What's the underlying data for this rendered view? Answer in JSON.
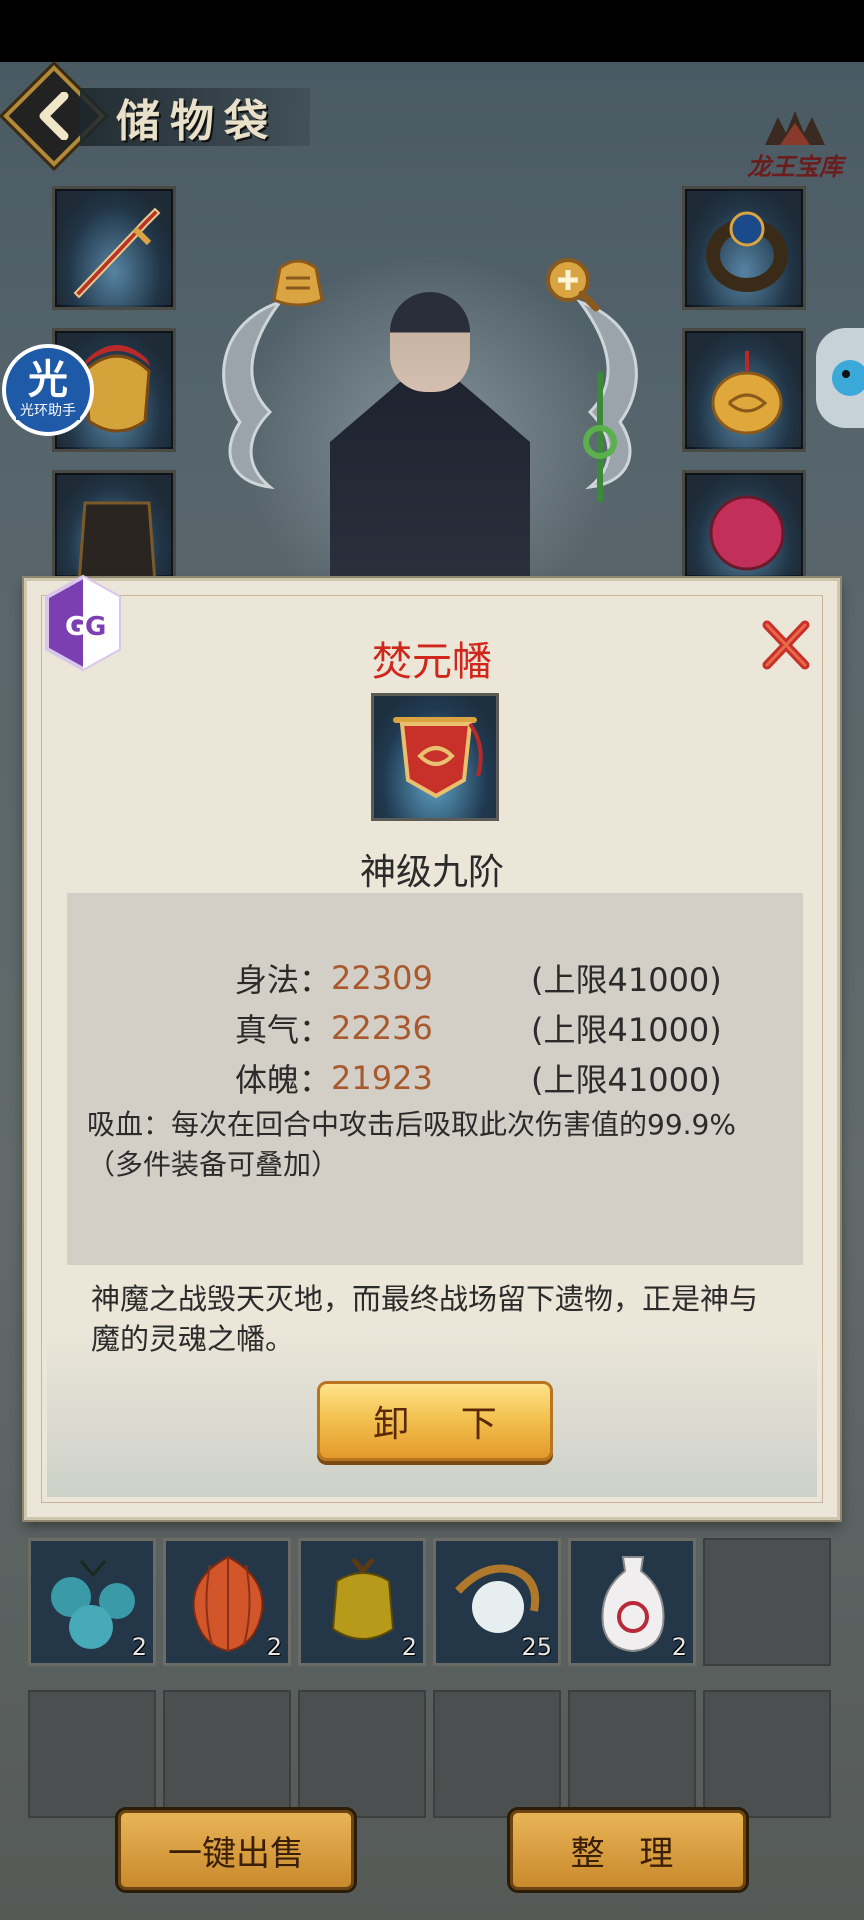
{
  "header": {
    "title": "储物袋",
    "logo_text": "龙王宝库"
  },
  "overlay": {
    "assistant_badge_big": "光",
    "assistant_badge_small": "光环助手"
  },
  "item_detail": {
    "name": "焚元幡",
    "grade": "神级九阶",
    "stats": [
      {
        "label": "身法：",
        "value": "22309",
        "cap": "(上限41000)"
      },
      {
        "label": "真气：",
        "value": "22236",
        "cap": "(上限41000)"
      },
      {
        "label": "体魄：",
        "value": "21923",
        "cap": "(上限41000)"
      }
    ],
    "lifesteal_line1": "吸血：每次在回合中攻击后吸取此次伤害值的99.9%",
    "lifesteal_line2": "（多件装备可叠加）",
    "description": "神魔之战毁天灭地，而最终战场留下遗物，正是神与魔的灵魂之幡。",
    "unequip_label": "卸 下"
  },
  "bag": {
    "items": [
      {
        "icon": "blue-gourd-fruit-icon",
        "count": "2"
      },
      {
        "icon": "orange-lantern-fruit-icon",
        "count": "2"
      },
      {
        "icon": "yellow-fruit-icon",
        "count": "2"
      },
      {
        "icon": "pearl-branch-icon",
        "count": "25"
      },
      {
        "icon": "porcelain-vase-icon",
        "count": "2"
      }
    ]
  },
  "footer": {
    "sell_label": "一键出售",
    "sort_label": "整 理"
  },
  "colors": {
    "item_name": "#d0261c",
    "stat_value": "#a85a2e",
    "button_gold": "#f3c251"
  }
}
